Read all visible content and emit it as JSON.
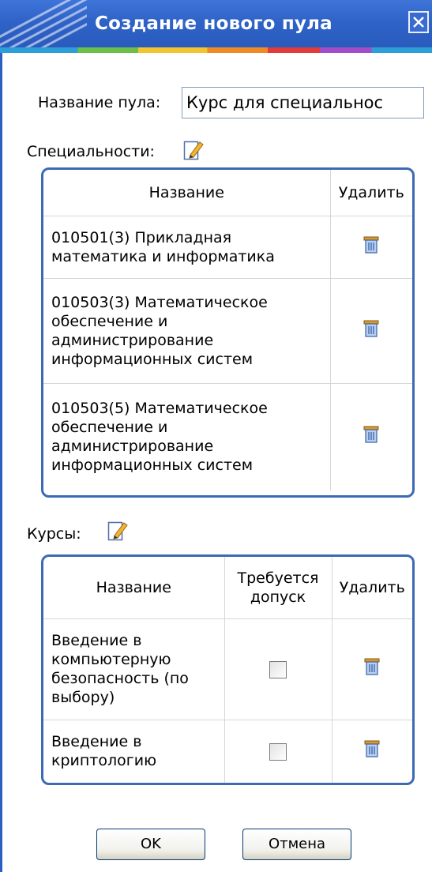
{
  "window": {
    "title": "Создание нового пула",
    "close_icon": "close-icon"
  },
  "form": {
    "pool_name_label": "Название пула:",
    "pool_name_value": "Курс для специальнос"
  },
  "specialties": {
    "label": "Специальности:",
    "edit_icon": "edit-icon",
    "columns": {
      "name": "Название",
      "delete": "Удалить"
    },
    "rows": [
      {
        "name": "010501(3) Прикладная математика и информатика",
        "delete_icon": "trash-icon"
      },
      {
        "name": "010503(3) Математическое обеспечение и администрирование информационных систем",
        "delete_icon": "trash-icon"
      },
      {
        "name": "010503(5) Математическое обеспечение и администрирование информационных систем",
        "delete_icon": "trash-icon"
      }
    ]
  },
  "courses": {
    "label": "Курсы:",
    "edit_icon": "edit-icon",
    "columns": {
      "name": "Название",
      "requires_access": "Требуется допуск",
      "delete": "Удалить"
    },
    "rows": [
      {
        "name": "Введение в компьютерную безопасность (по выбору)",
        "requires_access": false,
        "delete_icon": "trash-icon"
      },
      {
        "name": "Введение в криптологию",
        "requires_access": false,
        "delete_icon": "trash-icon"
      }
    ]
  },
  "buttons": {
    "ok": "OK",
    "cancel": "Отмена"
  },
  "colors": {
    "titlebar": "#2f63c8",
    "panel_border": "#3c6ab5"
  }
}
